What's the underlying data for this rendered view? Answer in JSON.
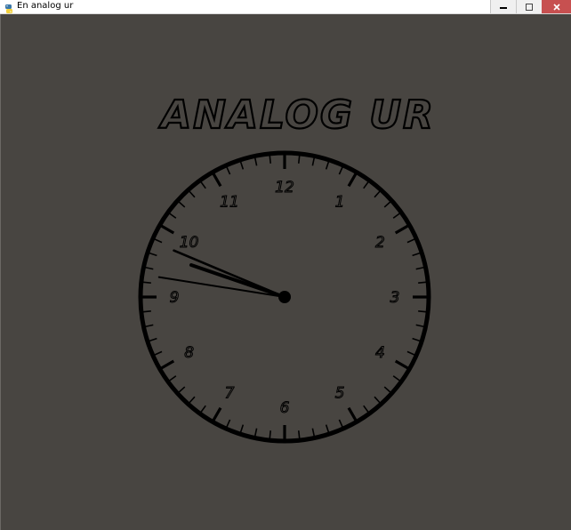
{
  "window": {
    "title": "En analog ur",
    "app_icon": "python-snake-icon",
    "controls": {
      "minimize_icon": "minimize-icon",
      "maximize_icon": "maximize-icon",
      "close_icon": "close-icon"
    }
  },
  "clock": {
    "heading": "ANALOG UR",
    "numerals": [
      "12",
      "1",
      "2",
      "3",
      "4",
      "5",
      "6",
      "7",
      "8",
      "9",
      "10",
      "11"
    ],
    "time": {
      "hour_hand_position": 9.63,
      "minute_hand_position": 48.8,
      "second_hand_position": 46.5
    }
  },
  "colors": {
    "background": "#484541",
    "ink": "#000000",
    "titlebar": "#ffffff",
    "close_button": "#c75050"
  }
}
